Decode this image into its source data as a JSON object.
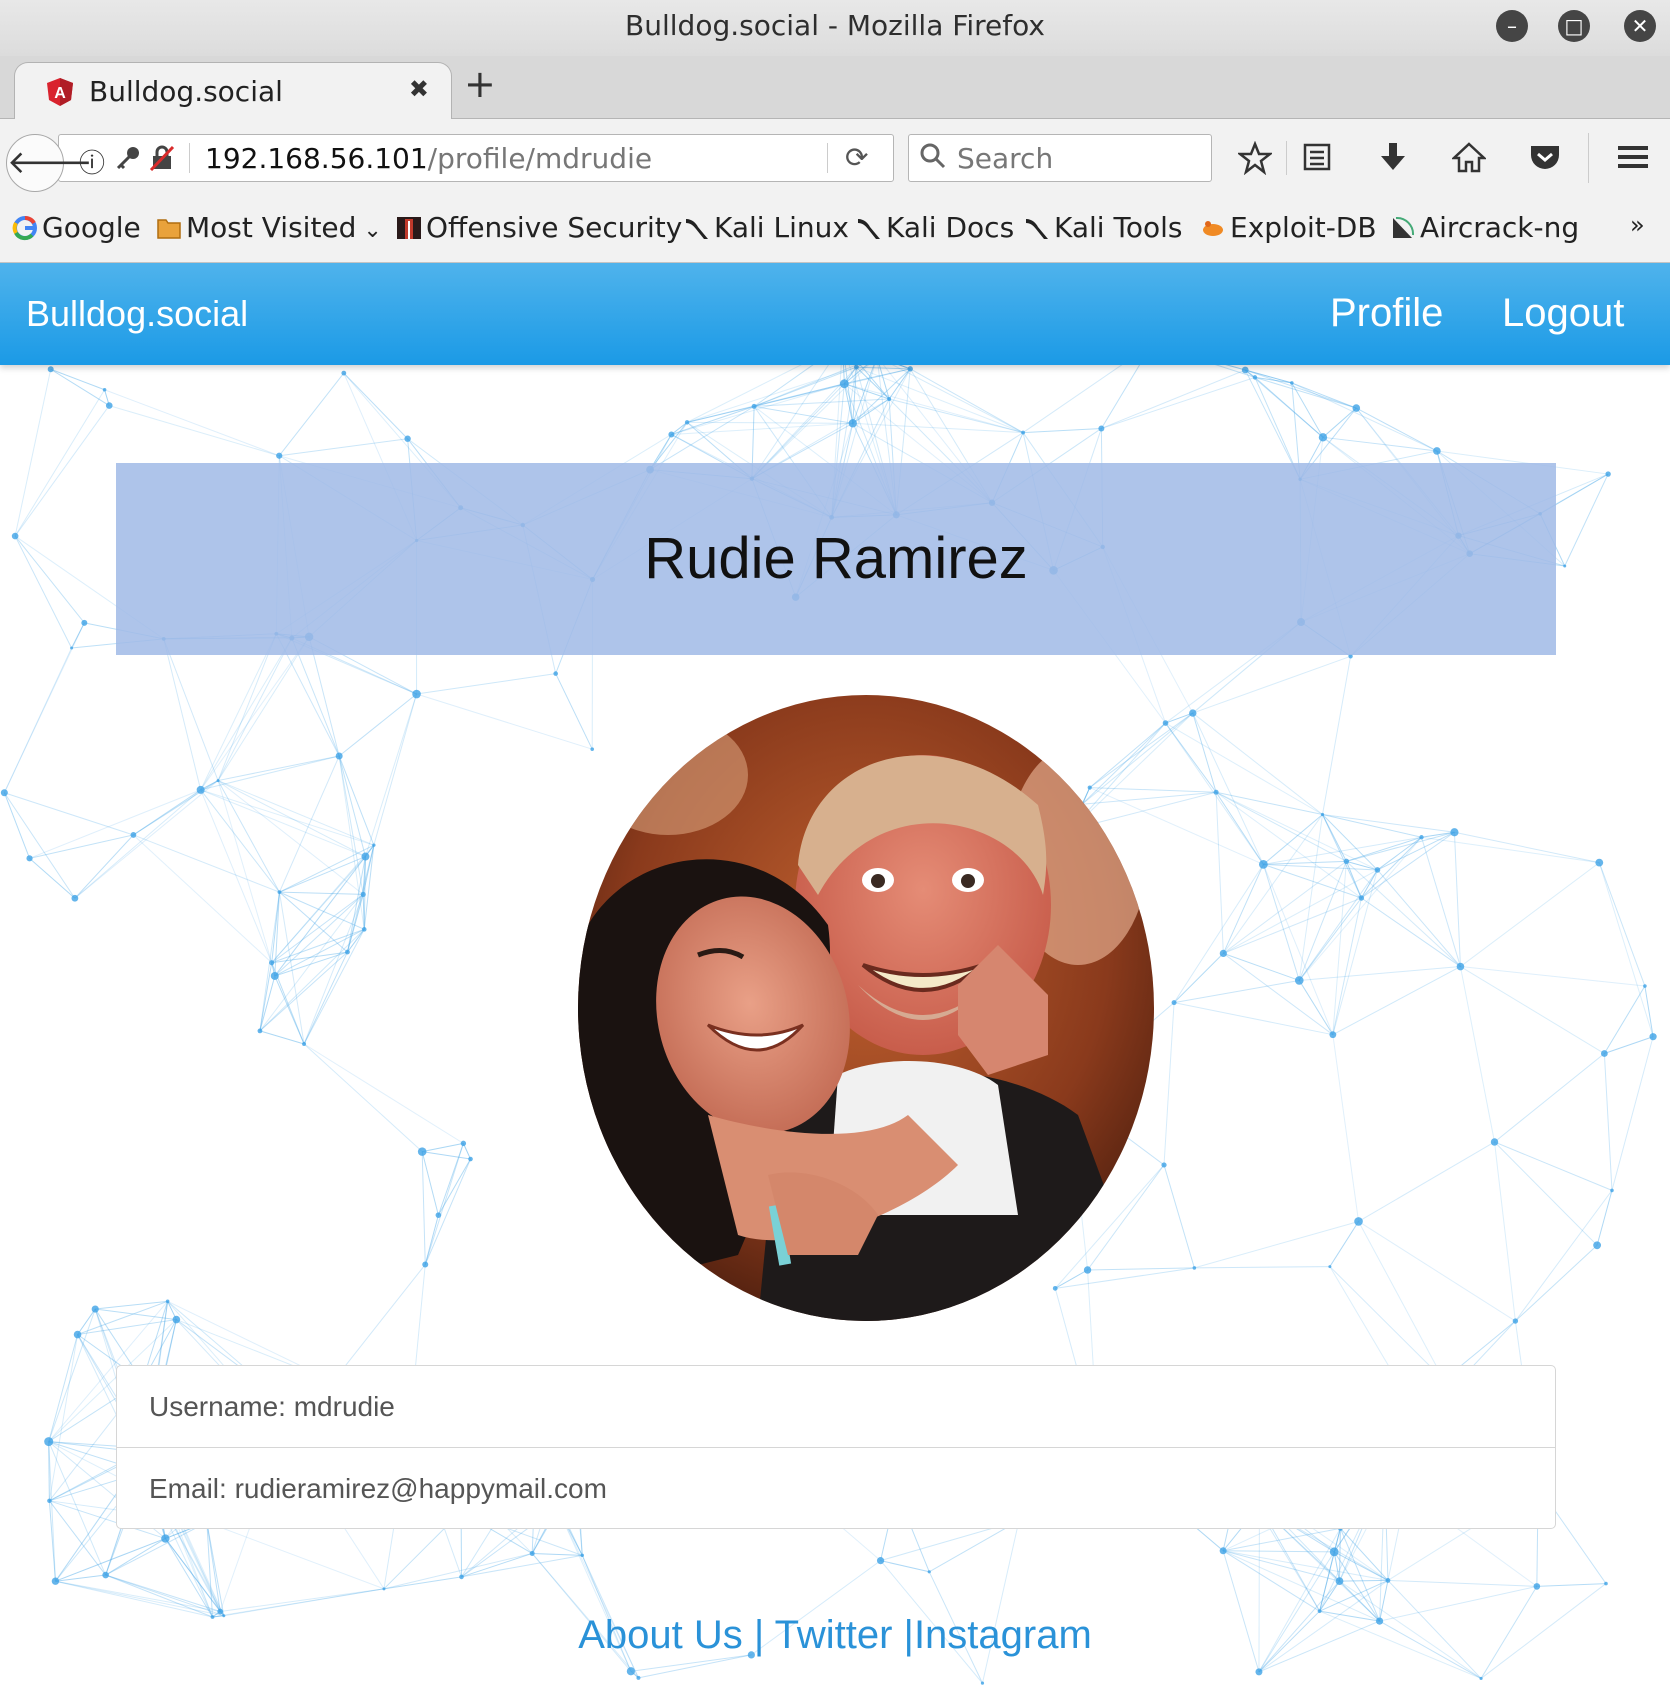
{
  "window": {
    "title": "Bulldog.social - Mozilla Firefox"
  },
  "tab": {
    "title": "Bulldog.social",
    "favicon_letter": "A"
  },
  "address_bar": {
    "host": "192.168.56.101",
    "path": "/profile/mdrudie"
  },
  "search": {
    "placeholder": "Search"
  },
  "bookmarks": [
    {
      "label": "Google",
      "icon": "google-icon"
    },
    {
      "label": "Most Visited",
      "icon": "folder-icon"
    },
    {
      "label": "Offensive Security",
      "icon": "offsec-icon"
    },
    {
      "label": "Kali Linux",
      "icon": "kali-icon"
    },
    {
      "label": "Kali Docs",
      "icon": "kali-icon"
    },
    {
      "label": "Kali Tools",
      "icon": "kali-icon"
    },
    {
      "label": "Exploit-DB",
      "icon": "exploitdb-icon"
    },
    {
      "label": "Aircrack-ng",
      "icon": "aircrack-icon"
    }
  ],
  "bookmarks_overflow": "»",
  "app": {
    "brand": "Bulldog.social",
    "nav": {
      "profile": "Profile",
      "logout": "Logout"
    },
    "accent_color": "#1b9ae6"
  },
  "profile": {
    "full_name": "Rudie Ramirez",
    "username_line": "Username: mdrudie",
    "email_line": "Email: rudieramirez@happymail.com"
  },
  "footer": {
    "about": "About Us",
    "sep1": " | ",
    "twitter": "Twitter",
    "sep2": " |",
    "instagram": "Instagram"
  }
}
